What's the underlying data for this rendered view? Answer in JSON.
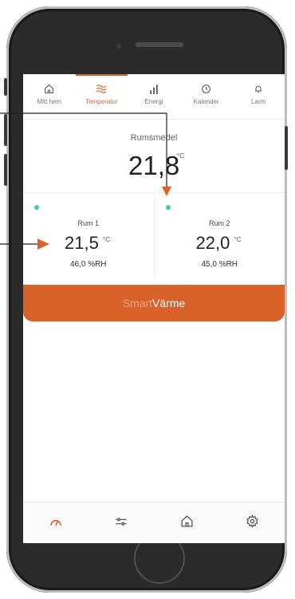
{
  "tabs": [
    {
      "label": "Mitt hem",
      "icon": "home-icon",
      "active": false
    },
    {
      "label": "Temperatur",
      "icon": "heat-waves-icon",
      "active": true
    },
    {
      "label": "Energi",
      "icon": "bar-chart-icon",
      "active": false
    },
    {
      "label": "Kalender",
      "icon": "clock-icon",
      "active": false
    },
    {
      "label": "Larm",
      "icon": "bell-icon",
      "active": false
    }
  ],
  "average": {
    "label": "Rumsmedel",
    "value": "21,8",
    "unit": "°C"
  },
  "rooms": [
    {
      "name": "Rum 1",
      "temp": "21,5",
      "unit": "°C",
      "humidity": "46,0 %RH",
      "status_color": "#3fcf9c"
    },
    {
      "name": "Rum 2",
      "temp": "22,0",
      "unit": "°C",
      "humidity": "45,0 %RH",
      "status_color": "#3fcf9c"
    }
  ],
  "smart_button": {
    "part1": "Smart",
    "part2": "Värme"
  },
  "bottom_nav": [
    {
      "icon": "gauge-icon",
      "active": true
    },
    {
      "icon": "sliders-icon",
      "active": false
    },
    {
      "icon": "home-icon",
      "active": false
    },
    {
      "icon": "gear-icon",
      "active": false
    }
  ],
  "colors": {
    "accent": "#d9622b",
    "status": "#3fcf9c"
  }
}
